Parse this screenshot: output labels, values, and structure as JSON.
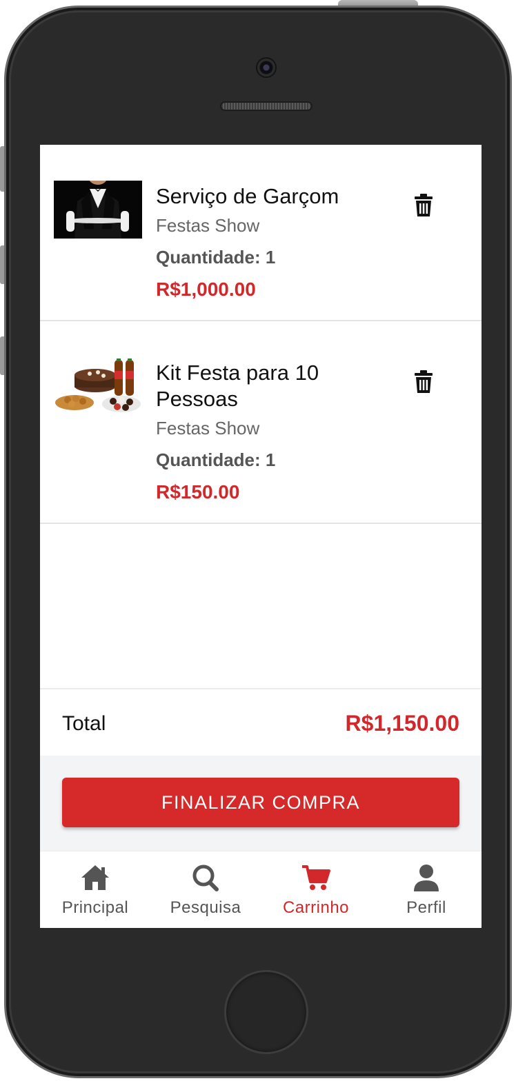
{
  "cart": {
    "items": [
      {
        "title": "Serviço de Garçom",
        "store": "Festas Show",
        "quantity": "Quantidade: 1",
        "price": "R$1,000.00",
        "image_icon": "waiter-photo",
        "remove_icon": "trash-icon"
      },
      {
        "title": "Kit Festa para 10 Pessoas",
        "store": "Festas Show",
        "quantity": "Quantidade: 1",
        "price": "R$150.00",
        "image_icon": "party-kit-photo",
        "remove_icon": "trash-icon"
      }
    ]
  },
  "summary": {
    "total_label": "Total",
    "total_value": "R$1,150.00"
  },
  "checkout": {
    "button_label": "FINALIZAR COMPRA"
  },
  "nav": {
    "items": [
      {
        "label": "Principal",
        "icon": "home-icon",
        "active": false
      },
      {
        "label": "Pesquisa",
        "icon": "search-icon",
        "active": false
      },
      {
        "label": "Carrinho",
        "icon": "cart-icon",
        "active": true
      },
      {
        "label": "Perfil",
        "icon": "user-icon",
        "active": false
      }
    ]
  },
  "colors": {
    "accent": "#d2282b",
    "text_primary": "#111111",
    "text_secondary": "#666666",
    "nav_inactive": "#555555",
    "checkout_bg": "#f3f4f6"
  }
}
